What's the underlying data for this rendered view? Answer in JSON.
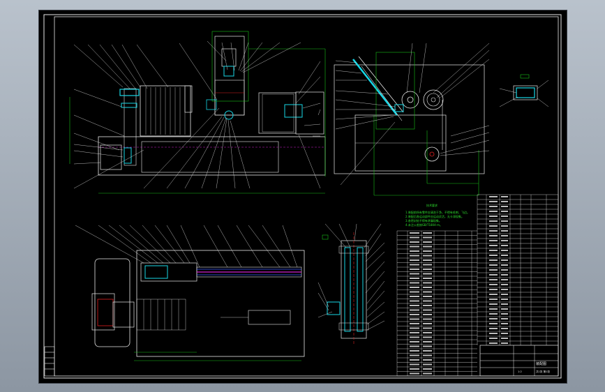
{
  "drawing": {
    "title_block_label": "装配图",
    "tech_req_title": "技术要求",
    "tech_req_lines": [
      "1.装配前所有零件应清洗干净，不得有毛刺、飞边。",
      "2.装配后各运动部件应运动灵活，无卡滞现象。",
      "3.各密封处不得有渗漏现象。",
      "4.未注公差按GB/T1804-m。"
    ],
    "scale_text": "1:2",
    "sheet_text": "共1张 第1张"
  },
  "colors": {
    "background": "#000000",
    "frame": "#e8e8e8",
    "dimension": "#18c018",
    "part": "#17d7e6",
    "center": "#e02020"
  }
}
